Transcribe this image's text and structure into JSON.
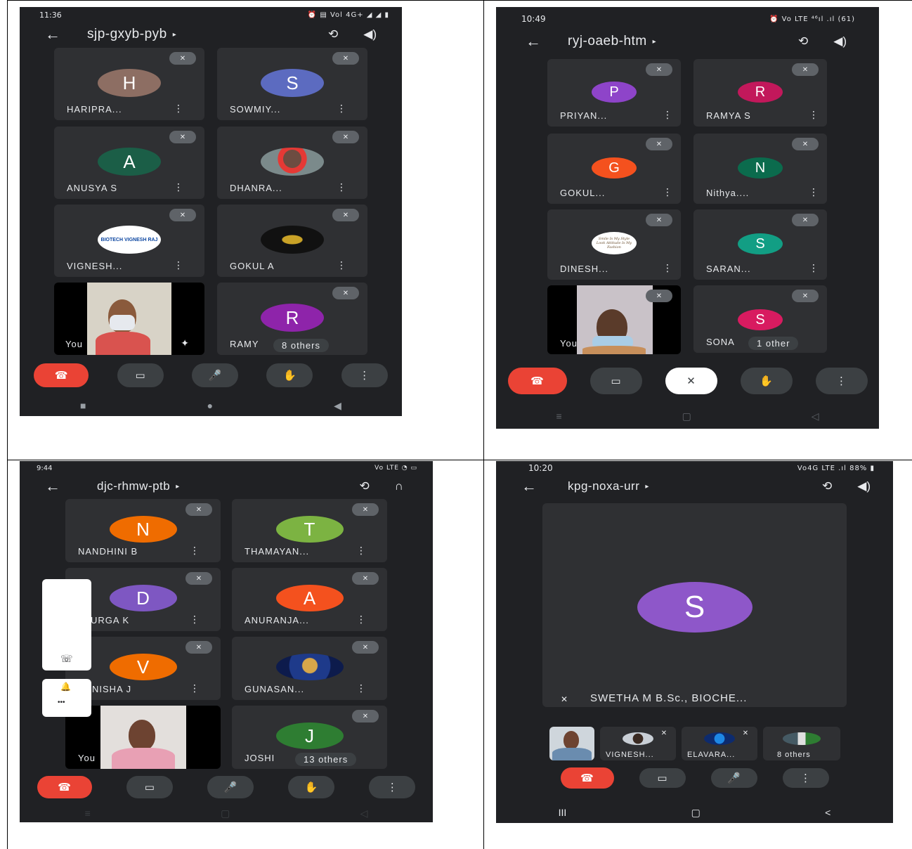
{
  "q1": {
    "status_time": "11:36",
    "status_right": "⏰ ▤ Vol 4G+ ◢ ◢ ▮",
    "meeting_code": "sjp-gxyb-pyb",
    "tiles": [
      {
        "letter": "H",
        "name": "HARIPRA...",
        "color": "#8d6e63"
      },
      {
        "letter": "S",
        "name": "SOWMIY...",
        "color": "#5c6bc0"
      },
      {
        "letter": "A",
        "name": "ANUSYA S",
        "color": "#1b5e47"
      },
      {
        "letter": "",
        "name": "DHANRA...",
        "color": "#9e9e9e"
      },
      {
        "letter": "",
        "name": "VIGNESH...",
        "color": "#ffffff",
        "logo_text": "BIOTECH VIGNESH RAJ"
      },
      {
        "letter": "",
        "name": "GOKUL A",
        "color": "#111111"
      },
      {
        "letter": "",
        "name": "You",
        "color": ""
      },
      {
        "letter": "R",
        "name": "RAMY",
        "color": "#8e24aa"
      }
    ],
    "others": "8 others"
  },
  "q2": {
    "status_time": "10:49",
    "status_right": "⏰ Vo LTE ⁴⁶ıl .ıl (61)",
    "meeting_code": "ryj-oaeb-htm",
    "tiles": [
      {
        "letter": "P",
        "name": "PRIYAN...",
        "color": "#8e44c9"
      },
      {
        "letter": "R",
        "name": "RAMYA S",
        "color": "#c2185b"
      },
      {
        "letter": "G",
        "name": "GOKUL...",
        "color": "#f4511e"
      },
      {
        "letter": "N",
        "name": "Nithya....",
        "color": "#0b6b4d"
      },
      {
        "letter": "",
        "name": "DINESH...",
        "color": "#ffffff",
        "logo_text": "Smile Is My Style Look Attitude Is My Fashion"
      },
      {
        "letter": "S",
        "name": "SARAN...",
        "color": "#129e84"
      },
      {
        "letter": "",
        "name": "You",
        "color": ""
      },
      {
        "letter": "S",
        "name": "SONA",
        "color": "#d81b60"
      }
    ],
    "others": "1 other"
  },
  "q3": {
    "status_time": "9:44",
    "status_right": "Vo LTE ◔ ▭",
    "meeting_code": "djc-rhmw-ptb",
    "tiles": [
      {
        "letter": "N",
        "name": "NANDHINI B",
        "color": "#ef6c00"
      },
      {
        "letter": "T",
        "name": "THAMAYAN...",
        "color": "#7cb342"
      },
      {
        "letter": "D",
        "name": "URGA K",
        "color": "#7e57c2"
      },
      {
        "letter": "A",
        "name": "ANURANJA...",
        "color": "#f4511e"
      },
      {
        "letter": "V",
        "name": "NISHA J",
        "color": "#ef6c00"
      },
      {
        "letter": "",
        "name": "GUNASAN...",
        "color": "#3949ab"
      },
      {
        "letter": "",
        "name": "You",
        "color": ""
      },
      {
        "letter": "J",
        "name": "JOSHI",
        "color": "#2e7d32"
      }
    ],
    "others": "13 others"
  },
  "q4": {
    "status_time": "10:20",
    "status_right": "Vo4G LTE .ıl 88% ▮",
    "meeting_code": "kpg-noxa-urr",
    "main_letter": "S",
    "main_color": "#8e57c9",
    "main_name": "SWETHA M B.Sc., BIOCHE...",
    "thumbs": [
      {
        "name": "",
        "kind": "you"
      },
      {
        "name": "VIGNESH...",
        "kind": "photo"
      },
      {
        "name": "ELAVARA...",
        "kind": "photo"
      },
      {
        "name": "8 others",
        "kind": "group"
      }
    ]
  },
  "icons": {
    "back": "←",
    "caret": "▸",
    "camera_flip": "⟲",
    "speaker": "◀)",
    "headset": "∩",
    "end_call": "☎",
    "video": "▭",
    "mic": "🎤",
    "mic_off": "✕",
    "hand": "✋",
    "more": "⋮",
    "mute": "✕",
    "nav_square": "■",
    "nav_circle": "●",
    "nav_back": "◀",
    "nav_recent": "III",
    "nav_home": "▢",
    "nav_back_alt": "<",
    "sparkle": "✦",
    "bell": "🔔",
    "phone_side": "☏",
    "dots_h": "•••"
  }
}
